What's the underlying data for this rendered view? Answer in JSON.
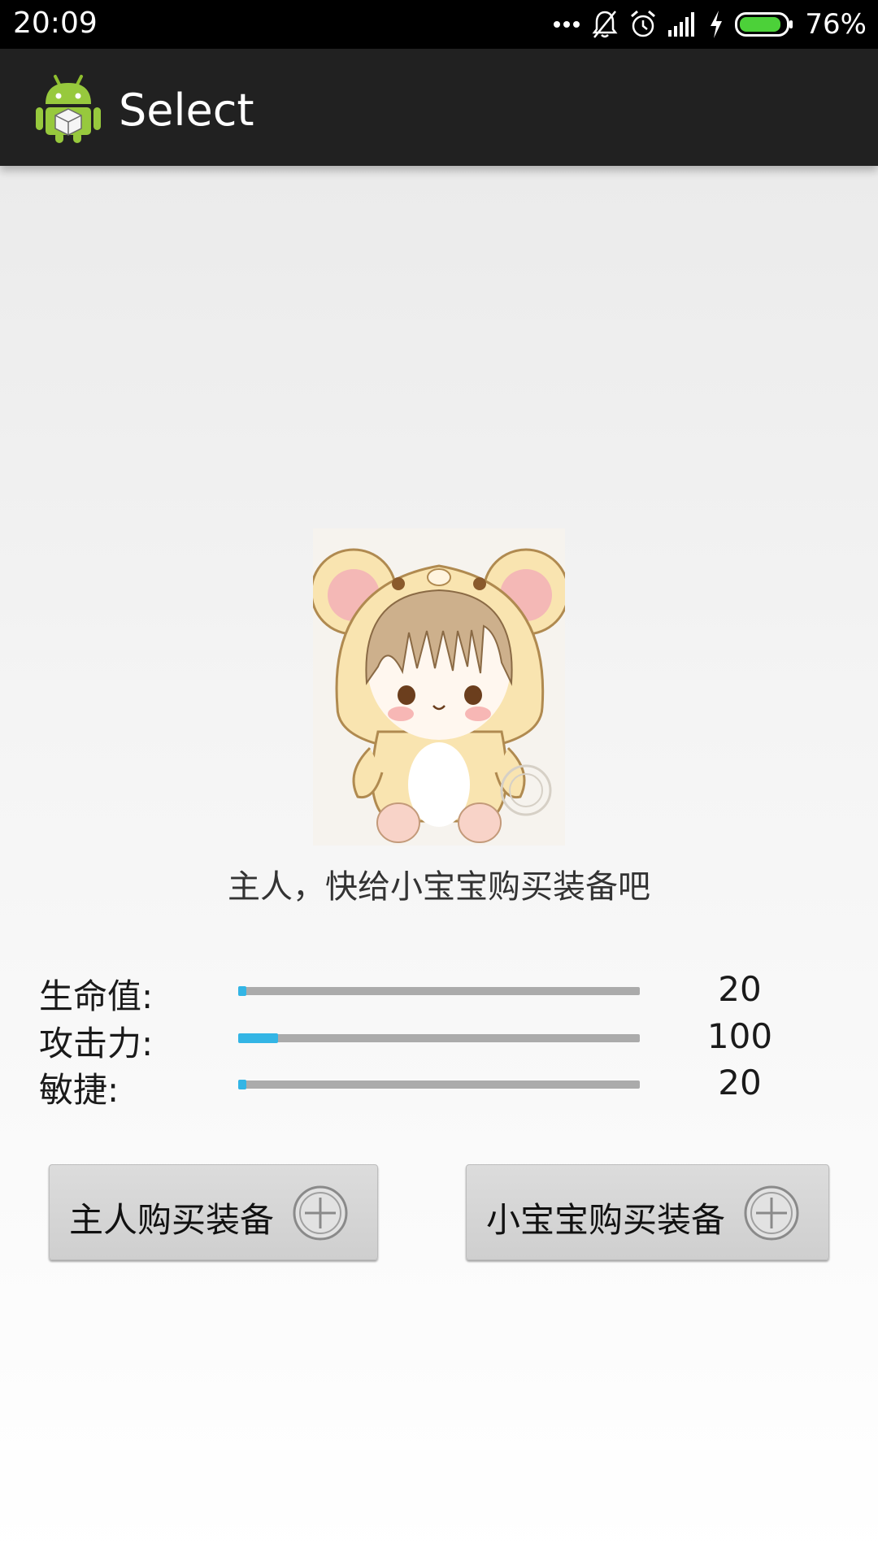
{
  "status_bar": {
    "time": "20:09",
    "battery": "76%",
    "icons": [
      "more-dots-icon",
      "notifications-off-icon",
      "alarm-icon",
      "signal-icon",
      "charging-icon",
      "battery-icon"
    ]
  },
  "action_bar": {
    "title": "Select",
    "icon": "android-app-icon"
  },
  "main": {
    "image": "chibi-girl-mouse-costume-image",
    "caption": "主人，快给小宝宝购买装备吧"
  },
  "stats": [
    {
      "label": "生命值:",
      "value": "20",
      "progress": 0.02
    },
    {
      "label": "攻击力:",
      "value": "100",
      "progress": 0.1
    },
    {
      "label": "敏捷:",
      "value": "20",
      "progress": 0.02
    }
  ],
  "buttons": [
    {
      "label": "主人购买装备",
      "icon": "add-circle-icon"
    },
    {
      "label": "小宝宝购买装备",
      "icon": "add-circle-icon"
    }
  ],
  "colors": {
    "accent": "#33b5e5",
    "action_bar": "#212121",
    "status_bar": "#000000",
    "battery": "#4cd139"
  }
}
